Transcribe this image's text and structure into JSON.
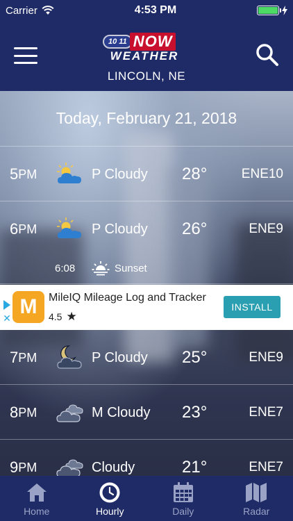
{
  "status_bar": {
    "carrier": "Carrier",
    "time": "4:53 PM",
    "battery_pct": 100
  },
  "header": {
    "logo_1011": "10 11",
    "logo_now": "NOW",
    "logo_weather": "WEATHER",
    "location": "LINCOLN, NE"
  },
  "date_label": "Today, February 21, 2018",
  "hours": [
    {
      "hour": "5",
      "ampm": "PM",
      "icon": "partly-cloudy-day-icon",
      "condition": "P Cloudy",
      "temp": "28°",
      "wind": "ENE10"
    },
    {
      "hour": "6",
      "ampm": "PM",
      "icon": "partly-cloudy-day-icon",
      "condition": "P Cloudy",
      "temp": "26°",
      "wind": "ENE9"
    },
    {
      "hour": "7",
      "ampm": "PM",
      "icon": "partly-cloudy-night-icon",
      "condition": "P Cloudy",
      "temp": "25°",
      "wind": "ENE9"
    },
    {
      "hour": "8",
      "ampm": "PM",
      "icon": "mostly-cloudy-night-icon",
      "condition": "M Cloudy",
      "temp": "23°",
      "wind": "ENE7"
    },
    {
      "hour": "9",
      "ampm": "PM",
      "icon": "cloudy-night-icon",
      "condition": "Cloudy",
      "temp": "21°",
      "wind": "ENE7"
    }
  ],
  "sunset": {
    "time": "6:08",
    "label": "Sunset"
  },
  "ad": {
    "logo_letter": "M",
    "title": "MileIQ Mileage Log and Tracker",
    "rating": "4.5",
    "install_label": "INSTALL"
  },
  "tabs": [
    {
      "label": "Home",
      "icon": "home-icon",
      "active": false
    },
    {
      "label": "Hourly",
      "icon": "clock-icon",
      "active": true
    },
    {
      "label": "Daily",
      "icon": "calendar-icon",
      "active": false
    },
    {
      "label": "Radar",
      "icon": "map-icon",
      "active": false
    }
  ],
  "colors": {
    "nav_bg": "#1f2b66",
    "battery": "#4cd964",
    "install": "#2a9fb1",
    "ad_logo": "#f5a623"
  }
}
